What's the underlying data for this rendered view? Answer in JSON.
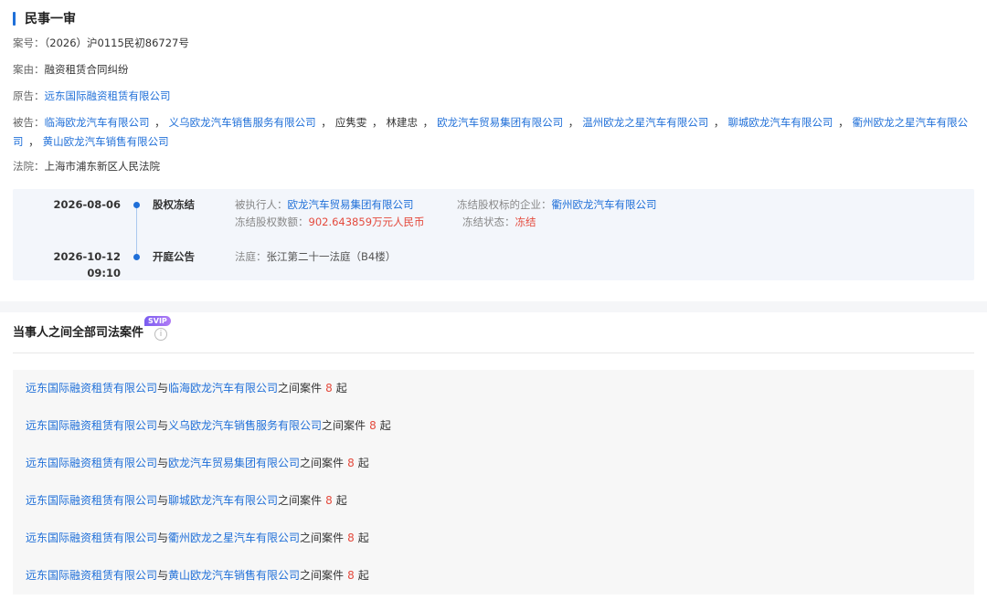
{
  "case": {
    "title": "民事一审",
    "number_label": "案号：",
    "number": "（2026）沪0115民初86727号",
    "cause_label": "案由：",
    "cause": "融资租赁合同纠纷",
    "plaintiff_label": "原告：",
    "plaintiff": "远东国际融资租赁有限公司",
    "defendant_label": "被告：",
    "defendants": [
      {
        "name": "临海欧龙汽车有限公司",
        "link": true
      },
      {
        "name": "义乌欧龙汽车销售服务有限公司",
        "link": true
      },
      {
        "name": "应隽雯",
        "link": false
      },
      {
        "name": "林建忠",
        "link": false
      },
      {
        "name": "欧龙汽车贸易集团有限公司",
        "link": true
      },
      {
        "name": "温州欧龙之星汽车有限公司",
        "link": true
      },
      {
        "name": "聊城欧龙汽车有限公司",
        "link": true
      },
      {
        "name": "衢州欧龙之星汽车有限公司",
        "link": true
      },
      {
        "name": "黄山欧龙汽车销售有限公司",
        "link": true
      }
    ],
    "court_label": "法院：",
    "court": "上海市浦东新区人民法院"
  },
  "timeline": [
    {
      "date": "2026-08-06",
      "time": "",
      "type": "股权冻结",
      "executed_label": "被执行人：",
      "executed": "欧龙汽车贸易集团有限公司",
      "target_label": "冻结股权标的企业：",
      "target": "衢州欧龙汽车有限公司",
      "amount_label": "冻结股权数额：",
      "amount": "902.643859万元人民币",
      "status_label": "冻结状态：",
      "status": "冻结"
    },
    {
      "date": "2026-10-12",
      "time": "09:10",
      "type": "开庭公告",
      "court_label": "法庭：",
      "court": "张江第二十一法庭（B4楼）"
    }
  ],
  "related": {
    "title": "当事人之间全部司法案件",
    "badge": "SVIP",
    "info_icon": "info-icon",
    "connector": "与",
    "between": "之间案件",
    "unit": "起",
    "items": [
      {
        "a": "远东国际融资租赁有限公司",
        "b": "临海欧龙汽车有限公司",
        "count": "8"
      },
      {
        "a": "远东国际融资租赁有限公司",
        "b": "义乌欧龙汽车销售服务有限公司",
        "count": "8"
      },
      {
        "a": "远东国际融资租赁有限公司",
        "b": "欧龙汽车贸易集团有限公司",
        "count": "8"
      },
      {
        "a": "远东国际融资租赁有限公司",
        "b": "聊城欧龙汽车有限公司",
        "count": "8"
      },
      {
        "a": "远东国际融资租赁有限公司",
        "b": "衢州欧龙之星汽车有限公司",
        "count": "8"
      },
      {
        "a": "远东国际融资租赁有限公司",
        "b": "黄山欧龙汽车销售有限公司",
        "count": "8"
      }
    ]
  },
  "colors": {
    "accent": "#1f6fd8",
    "red": "#e44a3d"
  }
}
